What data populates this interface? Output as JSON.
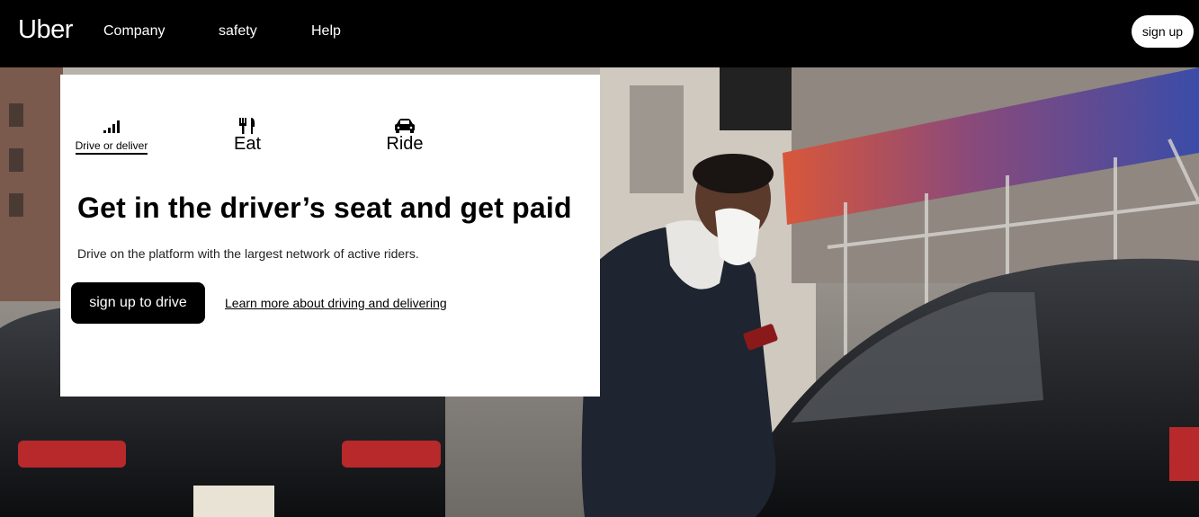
{
  "nav": {
    "logo": "Uber",
    "links": [
      {
        "label": "Company"
      },
      {
        "label": "safety"
      },
      {
        "label": "Help"
      }
    ],
    "signup_label": "sign up"
  },
  "card": {
    "tabs": [
      {
        "label": "Drive or deliver",
        "icon": "signal-bars-icon",
        "active": true
      },
      {
        "label": "Eat",
        "icon": "fork-knife-icon",
        "active": false
      },
      {
        "label": "Ride",
        "icon": "car-icon",
        "active": false
      }
    ],
    "headline": "Get in the driver’s seat and get paid",
    "subtext": "Drive on the platform with the largest network of active riders.",
    "primary_button": "sign up to drive",
    "secondary_link": "Learn more about driving and delivering"
  },
  "colors": {
    "nav_bg": "#000000",
    "card_bg": "#ffffff",
    "button_bg": "#000000",
    "awning": "#3a4ca8"
  }
}
